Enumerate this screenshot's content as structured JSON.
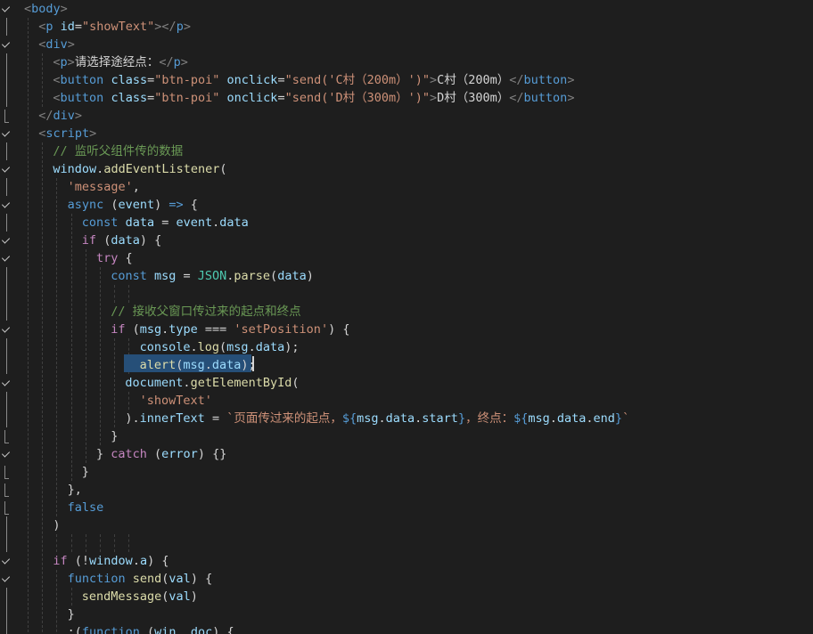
{
  "editor": {
    "lines": [
      {
        "indent": 1,
        "tokens": [
          [
            "t-tag",
            "<"
          ],
          [
            "t-tagname",
            "body"
          ],
          [
            "t-tag",
            ">"
          ]
        ]
      },
      {
        "indent": 2,
        "tokens": [
          [
            "t-tag",
            "<"
          ],
          [
            "t-tagname",
            "p"
          ],
          [
            "t-txt",
            " "
          ],
          [
            "t-attr",
            "id"
          ],
          [
            "t-txt",
            "="
          ],
          [
            "t-str",
            "\"showText\""
          ],
          [
            "t-tag",
            "></"
          ],
          [
            "t-tagname",
            "p"
          ],
          [
            "t-tag",
            ">"
          ]
        ]
      },
      {
        "indent": 2,
        "tokens": [
          [
            "t-tag",
            "<"
          ],
          [
            "t-tagname",
            "div"
          ],
          [
            "t-tag",
            ">"
          ]
        ]
      },
      {
        "indent": 3,
        "tokens": [
          [
            "t-tag",
            "<"
          ],
          [
            "t-tagname",
            "p"
          ],
          [
            "t-tag",
            ">"
          ],
          [
            "t-txt",
            "请选择途经点："
          ],
          [
            "t-tag",
            "</"
          ],
          [
            "t-tagname",
            "p"
          ],
          [
            "t-tag",
            ">"
          ]
        ]
      },
      {
        "indent": 3,
        "tokens": [
          [
            "t-tag",
            "<"
          ],
          [
            "t-tagname",
            "button"
          ],
          [
            "t-txt",
            " "
          ],
          [
            "t-attr",
            "class"
          ],
          [
            "t-txt",
            "="
          ],
          [
            "t-str",
            "\"btn-poi\""
          ],
          [
            "t-txt",
            " "
          ],
          [
            "t-attr",
            "onclick"
          ],
          [
            "t-txt",
            "="
          ],
          [
            "t-str",
            "\"send('C村（200m）')\""
          ],
          [
            "t-tag",
            ">"
          ],
          [
            "t-txt",
            "C村（200m）"
          ],
          [
            "t-tag",
            "</"
          ],
          [
            "t-tagname",
            "button"
          ],
          [
            "t-tag",
            ">"
          ]
        ]
      },
      {
        "indent": 3,
        "tokens": [
          [
            "t-tag",
            "<"
          ],
          [
            "t-tagname",
            "button"
          ],
          [
            "t-txt",
            " "
          ],
          [
            "t-attr",
            "class"
          ],
          [
            "t-txt",
            "="
          ],
          [
            "t-str",
            "\"btn-poi\""
          ],
          [
            "t-txt",
            " "
          ],
          [
            "t-attr",
            "onclick"
          ],
          [
            "t-txt",
            "="
          ],
          [
            "t-str",
            "\"send('D村（300m）')\""
          ],
          [
            "t-tag",
            ">"
          ],
          [
            "t-txt",
            "D村（300m）"
          ],
          [
            "t-tag",
            "</"
          ],
          [
            "t-tagname",
            "button"
          ],
          [
            "t-tag",
            ">"
          ]
        ]
      },
      {
        "indent": 2,
        "tokens": [
          [
            "t-tag",
            "</"
          ],
          [
            "t-tagname",
            "div"
          ],
          [
            "t-tag",
            ">"
          ]
        ]
      },
      {
        "indent": 2,
        "tokens": [
          [
            "t-tag",
            "<"
          ],
          [
            "t-tagname",
            "script"
          ],
          [
            "t-tag",
            ">"
          ]
        ]
      },
      {
        "indent": 3,
        "tokens": [
          [
            "t-com",
            "// 监听父组件传的数据"
          ]
        ]
      },
      {
        "indent": 3,
        "tokens": [
          [
            "t-var",
            "window"
          ],
          [
            "t-txt",
            "."
          ],
          [
            "t-fn",
            "addEventListener"
          ],
          [
            "t-txt",
            "("
          ]
        ]
      },
      {
        "indent": 4,
        "tokens": [
          [
            "t-str",
            "'message'"
          ],
          [
            "t-txt",
            ","
          ]
        ]
      },
      {
        "indent": 4,
        "tokens": [
          [
            "t-kw",
            "async"
          ],
          [
            "t-txt",
            " ("
          ],
          [
            "t-var",
            "event"
          ],
          [
            "t-txt",
            ") "
          ],
          [
            "t-kw",
            "=>"
          ],
          [
            "t-txt",
            " {"
          ]
        ]
      },
      {
        "indent": 5,
        "tokens": [
          [
            "t-kw",
            "const"
          ],
          [
            "t-txt",
            " "
          ],
          [
            "t-var",
            "data"
          ],
          [
            "t-txt",
            " = "
          ],
          [
            "t-var",
            "event"
          ],
          [
            "t-txt",
            "."
          ],
          [
            "t-var",
            "data"
          ]
        ]
      },
      {
        "indent": 5,
        "tokens": [
          [
            "t-ctl",
            "if"
          ],
          [
            "t-txt",
            " ("
          ],
          [
            "t-var",
            "data"
          ],
          [
            "t-txt",
            ") {"
          ]
        ]
      },
      {
        "indent": 6,
        "tokens": [
          [
            "t-ctl",
            "try"
          ],
          [
            "t-txt",
            " {"
          ]
        ]
      },
      {
        "indent": 7,
        "tokens": [
          [
            "t-kw",
            "const"
          ],
          [
            "t-txt",
            " "
          ],
          [
            "t-var",
            "msg"
          ],
          [
            "t-txt",
            " = "
          ],
          [
            "t-cls",
            "JSON"
          ],
          [
            "t-txt",
            "."
          ],
          [
            "t-fn",
            "parse"
          ],
          [
            "t-txt",
            "("
          ],
          [
            "t-var",
            "data"
          ],
          [
            "t-txt",
            ")"
          ]
        ]
      },
      {
        "indent": 7,
        "tokens": []
      },
      {
        "indent": 7,
        "tokens": [
          [
            "t-com",
            "// 接收父窗口传过来的起点和终点"
          ]
        ]
      },
      {
        "indent": 7,
        "tokens": [
          [
            "t-ctl",
            "if"
          ],
          [
            "t-txt",
            " ("
          ],
          [
            "t-var",
            "msg"
          ],
          [
            "t-txt",
            "."
          ],
          [
            "t-var",
            "type"
          ],
          [
            "t-txt",
            " === "
          ],
          [
            "t-str",
            "'setPosition'"
          ],
          [
            "t-txt",
            ") {"
          ]
        ]
      },
      {
        "indent": 9,
        "tokens": [
          [
            "t-var",
            "console"
          ],
          [
            "t-txt",
            "."
          ],
          [
            "t-fn",
            "log"
          ],
          [
            "t-txt",
            "("
          ],
          [
            "t-var",
            "msg"
          ],
          [
            "t-txt",
            "."
          ],
          [
            "t-var",
            "data"
          ],
          [
            "t-txt",
            ");"
          ]
        ]
      },
      {
        "indent": 9,
        "tokens": [
          [
            "t-fn",
            "alert"
          ],
          [
            "t-txt",
            "("
          ],
          [
            "t-var",
            "msg"
          ],
          [
            "t-txt",
            "."
          ],
          [
            "t-var",
            "data"
          ],
          [
            "t-txt",
            ");"
          ]
        ]
      },
      {
        "indent": 8,
        "tokens": [
          [
            "t-var",
            "document"
          ],
          [
            "t-txt",
            "."
          ],
          [
            "t-fn",
            "getElementById"
          ],
          [
            "t-txt",
            "("
          ]
        ]
      },
      {
        "indent": 9,
        "tokens": [
          [
            "t-str",
            "'showText'"
          ]
        ]
      },
      {
        "indent": 8,
        "tokens": [
          [
            "t-txt",
            ")."
          ],
          [
            "t-var",
            "innerText"
          ],
          [
            "t-txt",
            " = "
          ],
          [
            "t-str",
            "`页面传过来的起点，"
          ],
          [
            "t-kw",
            "${"
          ],
          [
            "t-var",
            "msg"
          ],
          [
            "t-txt",
            "."
          ],
          [
            "t-var",
            "data"
          ],
          [
            "t-txt",
            "."
          ],
          [
            "t-var",
            "start"
          ],
          [
            "t-kw",
            "}"
          ],
          [
            "t-str",
            "，终点："
          ],
          [
            "t-kw",
            "${"
          ],
          [
            "t-var",
            "msg"
          ],
          [
            "t-txt",
            "."
          ],
          [
            "t-var",
            "data"
          ],
          [
            "t-txt",
            "."
          ],
          [
            "t-var",
            "end"
          ],
          [
            "t-kw",
            "}"
          ],
          [
            "t-str",
            "`"
          ]
        ]
      },
      {
        "indent": 7,
        "tokens": [
          [
            "t-txt",
            "}"
          ]
        ]
      },
      {
        "indent": 6,
        "tokens": [
          [
            "t-txt",
            "} "
          ],
          [
            "t-ctl",
            "catch"
          ],
          [
            "t-txt",
            " ("
          ],
          [
            "t-var",
            "error"
          ],
          [
            "t-txt",
            ") {}"
          ]
        ]
      },
      {
        "indent": 5,
        "tokens": [
          [
            "t-txt",
            "}"
          ]
        ]
      },
      {
        "indent": 4,
        "tokens": [
          [
            "t-txt",
            "},"
          ]
        ]
      },
      {
        "indent": 4,
        "tokens": [
          [
            "t-kw",
            "false"
          ]
        ]
      },
      {
        "indent": 3,
        "tokens": [
          [
            "t-txt",
            ")"
          ]
        ]
      },
      {
        "indent": 3,
        "tokens": []
      },
      {
        "indent": 3,
        "tokens": [
          [
            "t-ctl",
            "if"
          ],
          [
            "t-txt",
            " (!"
          ],
          [
            "t-var",
            "window"
          ],
          [
            "t-txt",
            "."
          ],
          [
            "t-var",
            "a"
          ],
          [
            "t-txt",
            ") {"
          ]
        ]
      },
      {
        "indent": 4,
        "tokens": [
          [
            "t-kw",
            "function"
          ],
          [
            "t-txt",
            " "
          ],
          [
            "t-fn",
            "send"
          ],
          [
            "t-txt",
            "("
          ],
          [
            "t-var",
            "val"
          ],
          [
            "t-txt",
            ") {"
          ]
        ]
      },
      {
        "indent": 5,
        "tokens": [
          [
            "t-fn",
            "sendMessage"
          ],
          [
            "t-txt",
            "("
          ],
          [
            "t-var",
            "val"
          ],
          [
            "t-txt",
            ")"
          ]
        ]
      },
      {
        "indent": 4,
        "tokens": [
          [
            "t-txt",
            "}"
          ]
        ]
      },
      {
        "indent": 4,
        "tokens": [
          [
            "t-txt",
            ";("
          ],
          [
            "t-kw",
            "function"
          ],
          [
            "t-txt",
            " ("
          ],
          [
            "t-var",
            "win"
          ],
          [
            "t-txt",
            ", "
          ],
          [
            "t-var",
            "doc"
          ],
          [
            "t-txt",
            ") {"
          ]
        ]
      }
    ],
    "gutter_marks": [
      "check",
      "bar",
      "check",
      "bar",
      "bar",
      "bar",
      "bracket",
      "check",
      "bar",
      "check",
      "bar",
      "check",
      "bar",
      "check",
      "check",
      "bar",
      "bar",
      "bar",
      "check",
      "bar",
      "bar",
      "check",
      "bar",
      "bar",
      "bracket",
      "check",
      "bracket",
      "bracket",
      "bracket",
      "bar",
      "bar",
      "check",
      "check",
      "bar",
      "bar",
      "bar"
    ]
  }
}
